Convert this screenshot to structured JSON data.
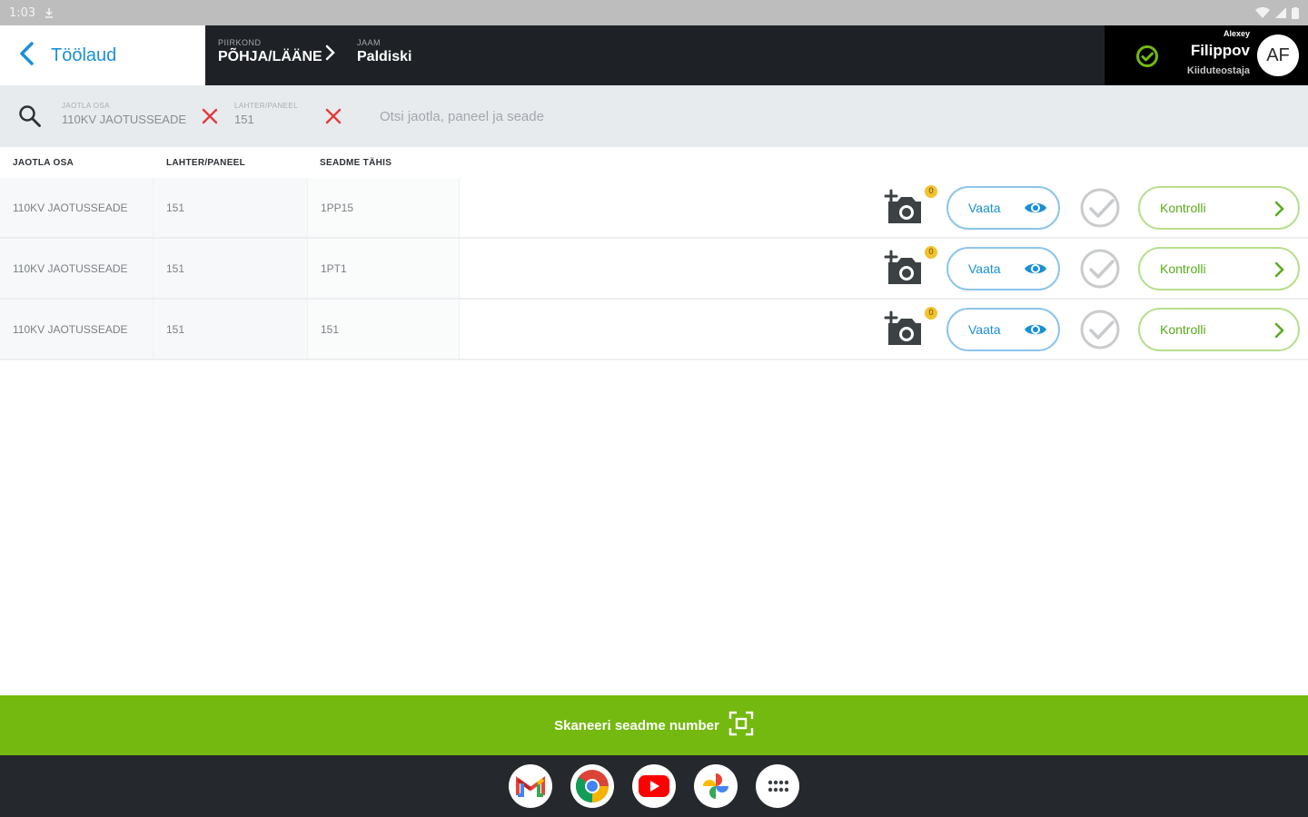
{
  "status": {
    "time": "1:03",
    "download_icon": "download-icon"
  },
  "header": {
    "back_label": "Töölaud",
    "crumbs": [
      {
        "caption": "PIIRKOND",
        "value": "PÕHJA/LÄÄNE"
      },
      {
        "caption": "JAAM",
        "value": "Paldiski"
      }
    ],
    "user": {
      "first": "Alexey",
      "last": "Filippov",
      "role": "Kiiduteostaja",
      "initials": "AF"
    }
  },
  "filters": {
    "chips": [
      {
        "caption": "JAOTLA OSA",
        "value": "110KV JAOTUSSEADE"
      },
      {
        "caption": "LAHTER/PANEEL",
        "value": "151"
      }
    ],
    "search_placeholder": "Otsi jaotla, paneel ja seade"
  },
  "table": {
    "headers": [
      "JAOTLA OSA",
      "LAHTER/PANEEL",
      "SEADME TÄHIS"
    ],
    "rows": [
      {
        "jaotla": "110KV JAOTUSSEADE",
        "lahter": "151",
        "seade": "1PP15",
        "photo_badge": "0"
      },
      {
        "jaotla": "110KV JAOTUSSEADE",
        "lahter": "151",
        "seade": "1PT1",
        "photo_badge": "0"
      },
      {
        "jaotla": "110KV JAOTUSSEADE",
        "lahter": "151",
        "seade": "151",
        "photo_badge": "0"
      }
    ],
    "view_label": "Vaata",
    "control_label": "Kontrolli"
  },
  "scan": {
    "label": "Skaneeri seadme number"
  },
  "dock": [
    "gmail-icon",
    "chrome-icon",
    "youtube-icon",
    "photos-icon",
    "apps-icon"
  ],
  "colors": {
    "accent_blue": "#1a8fd6",
    "accent_green": "#74b90f",
    "header_dark": "#1e2227"
  }
}
